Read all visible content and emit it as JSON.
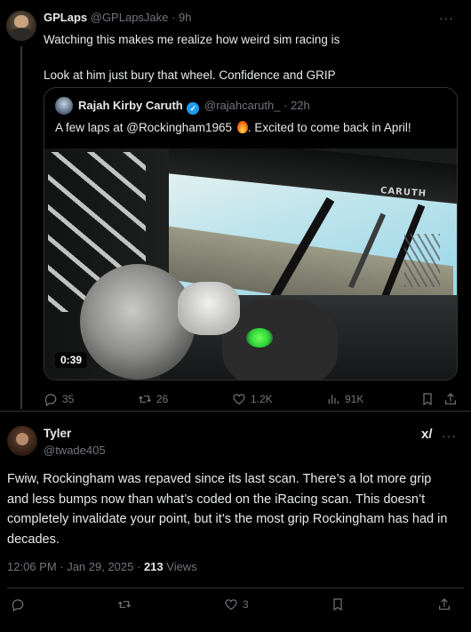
{
  "post": {
    "author_name": "GPLaps",
    "author_handle": "@GPLapsJake",
    "time": "9h",
    "more_icon": "more-icon",
    "text": "Watching this makes me realize how weird sim racing is\n\nLook at him just bury that wheel. Confidence and GRIP"
  },
  "quote": {
    "author_name": "Rajah Kirby Caruth",
    "verified": "verified-badge",
    "author_handle": "@rajahcaruth_",
    "time": "22h",
    "text": "A few laps at @Rockingham1965",
    "text_suffix": ". Excited to come back in April!",
    "emoji": "fire-emoji",
    "video_duration": "0:39",
    "video_brand_text": "CARUTH"
  },
  "post_actions": {
    "replies": "35",
    "reposts": "26",
    "likes": "1.2K",
    "views": "91K"
  },
  "reply": {
    "author_name": "Tyler",
    "author_handle": "@twade405",
    "grok_label": "x/",
    "text": "Fwiw, Rockingham was repaved since its last scan. There’s a lot more grip and less bumps now than what’s coded on the iRacing scan. This doesn’t completely invalidate your point, but it’s the most grip Rockingham has had in decades.",
    "timestamp": "12:06 PM · Jan 29, 2025",
    "dot": " · ",
    "views_count": "213",
    "views_label": " Views"
  },
  "reply_actions": {
    "likes": "3"
  },
  "colors": {
    "background": "#000000",
    "text": "#e7e9ea",
    "muted": "#71767b",
    "border": "#2f3336",
    "verified": "#1d9bf0"
  }
}
